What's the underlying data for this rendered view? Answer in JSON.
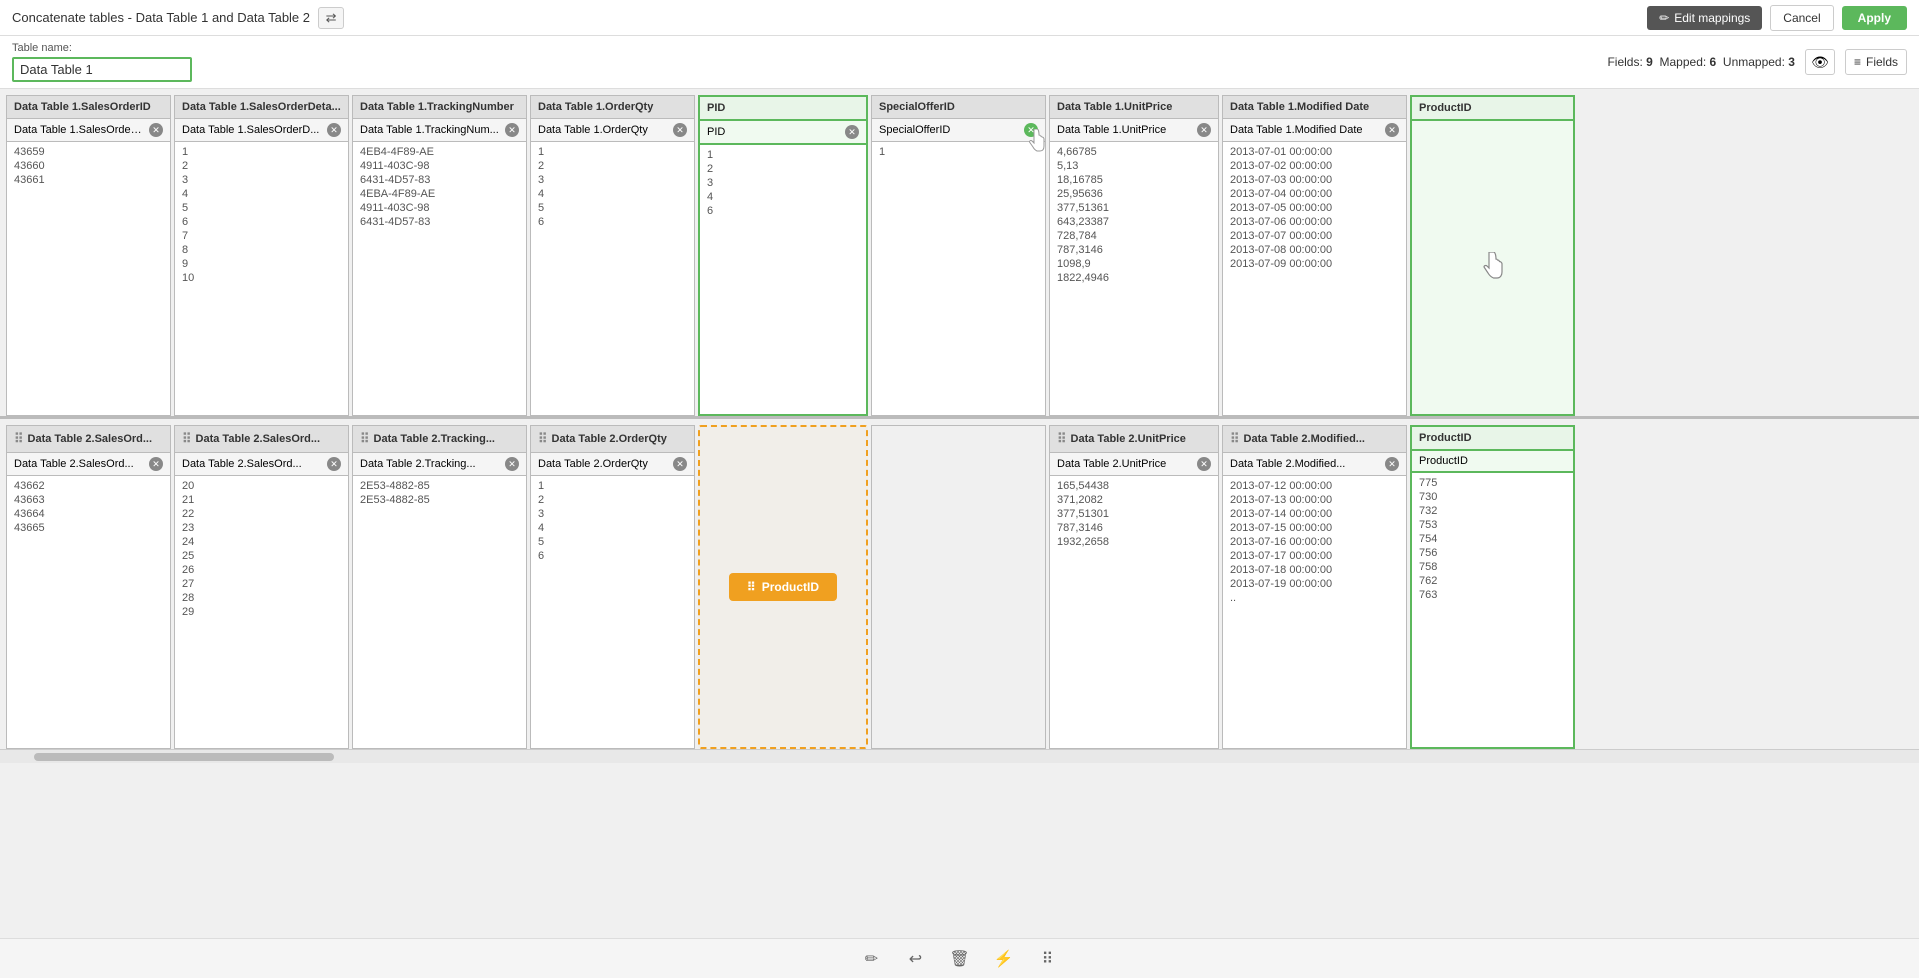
{
  "topBar": {
    "title": "Concatenate tables - Data Table 1 and Data Table 2",
    "swapIcon": "⇄",
    "editMappingsLabel": "Edit mappings",
    "cancelLabel": "Cancel",
    "applyLabel": "Apply"
  },
  "tableNameSection": {
    "label": "Table name:",
    "value": "Data Table 1",
    "fieldsInfo": "Fields: 9  Mapped: 6  Unmapped: 3",
    "fields9": "9",
    "mapped6": "6",
    "unmapped3": "3",
    "eyeIcon": "👁",
    "fieldsLabel": "Fields"
  },
  "topColumns": [
    {
      "header": "Data Table 1.SalesOrderID",
      "subheader": "Data Table 1.SalesOrderID",
      "data": [
        "43659",
        "43660",
        "43661",
        "",
        "",
        "",
        "",
        "",
        "",
        ""
      ]
    },
    {
      "header": "Data Table 1.SalesOrderDeta...",
      "subheader": "Data Table 1.SalesOrderD...",
      "data": [
        "1",
        "2",
        "3",
        "4",
        "5",
        "6",
        "7",
        "8",
        "9",
        "10"
      ]
    },
    {
      "header": "Data Table 1.TrackingNumber",
      "subheader": "Data Table 1.TrackingNum...",
      "data": [
        "4EB4-4F89-AE",
        "4911-403C-98",
        "6431-4D57-83",
        "4EBA-4F89-AE",
        "4911-403C-98",
        "6431-4D57-83",
        "",
        "",
        "",
        ""
      ]
    },
    {
      "header": "Data Table 1.OrderQty",
      "subheader": "Data Table 1.OrderQty",
      "data": [
        "1",
        "2",
        "3",
        "4",
        "5",
        "6",
        "",
        "",
        "",
        ""
      ]
    },
    {
      "header": "PID",
      "subheader": "PID",
      "isGreen": true,
      "data": [
        "1",
        "2",
        "3",
        "4",
        "6",
        "",
        "",
        "",
        "",
        ""
      ]
    },
    {
      "header": "SpecialOfferID",
      "subheader": "SpecialOfferID",
      "hasGreenClose": true,
      "data": [
        "1",
        "",
        "",
        "",
        "",
        "",
        "",
        "",
        "",
        ""
      ]
    },
    {
      "header": "Data Table 1.UnitPrice",
      "subheader": "Data Table 1.UnitPrice",
      "data": [
        "4,66785",
        "5,13",
        "18,16785",
        "25,95636",
        "377,51361",
        "643,23387",
        "728,784",
        "787,3146",
        "1098,9",
        "1822,4946"
      ]
    },
    {
      "header": "Data Table 1.Modified Date",
      "subheader": "Data Table 1.Modified Date",
      "data": [
        "2013-07-01 00:00:00",
        "2013-07-02 00:00:00",
        "2013-07-03 00:00:00",
        "2013-07-04 00:00:00",
        "2013-07-05 00:00:00",
        "2013-07-06 00:00:00",
        "2013-07-07 00:00:00",
        "2013-07-08 00:00:00",
        "2013-07-09 00:00:00",
        ""
      ]
    },
    {
      "header": "ProductID",
      "subheader": "ProductID",
      "isGreen": true,
      "isEmpty": true,
      "data": []
    }
  ],
  "bottomColumns": [
    {
      "header": "Data Table 2.SalesOrd...",
      "subheader": "Data Table 2.SalesOrd...",
      "data": [
        "43662",
        "43663",
        "43664",
        "43665",
        "",
        "",
        "",
        "",
        "",
        ""
      ]
    },
    {
      "header": "Data Table 2.SalesOrd...",
      "subheader": "Data Table 2.SalesOrd...",
      "data": [
        "20",
        "21",
        "22",
        "23",
        "24",
        "25",
        "26",
        "27",
        "28",
        "29"
      ]
    },
    {
      "header": "Data Table 2.Tracking...",
      "subheader": "Data Table 2.Tracking...",
      "data": [
        "2E53-4882-85",
        "2E53-4882-85",
        "",
        "",
        "",
        "",
        "",
        "",
        "",
        ""
      ]
    },
    {
      "header": "Data Table 2.OrderQty",
      "subheader": "Data Table 2.OrderQty",
      "data": [
        "1",
        "2",
        "3",
        "4",
        "5",
        "6",
        "",
        "",
        "",
        ""
      ]
    },
    {
      "header": "ProductID_drop",
      "isDragDrop": true,
      "dragLabel": "ProductID"
    },
    {
      "header": "SpecialOfferID_drop",
      "isEmpty": true,
      "data": []
    },
    {
      "header": "Data Table 2.UnitPrice",
      "subheader": "Data Table 2.UnitPrice",
      "data": [
        "165,54438",
        "371,2082",
        "377,51301",
        "787,3146",
        "1932,2658",
        "",
        "",
        "",
        "",
        ""
      ]
    },
    {
      "header": "Data Table 2.Modified...",
      "subheader": "Data Table 2.Modified...",
      "data": [
        "2013-07-12 00:00:00",
        "2013-07-13 00:00:00",
        "2013-07-14 00:00:00",
        "2013-07-15 00:00:00",
        "2013-07-16 00:00:00",
        "2013-07-17 00:00:00",
        "2013-07-18 00:00:00",
        "2013-07-19 00:00:00",
        "..",
        ""
      ]
    },
    {
      "header": "ProductID_bottom",
      "subheader": "ProductID",
      "isGreenBorder": true,
      "data": [
        "775",
        "730",
        "732",
        "753",
        "754",
        "756",
        "758",
        "762",
        "763",
        ""
      ]
    }
  ],
  "bottomToolbar": {
    "icons": [
      "✏️",
      "↩️",
      "🗑️",
      "⚡",
      "⋮⋮⋮"
    ]
  }
}
